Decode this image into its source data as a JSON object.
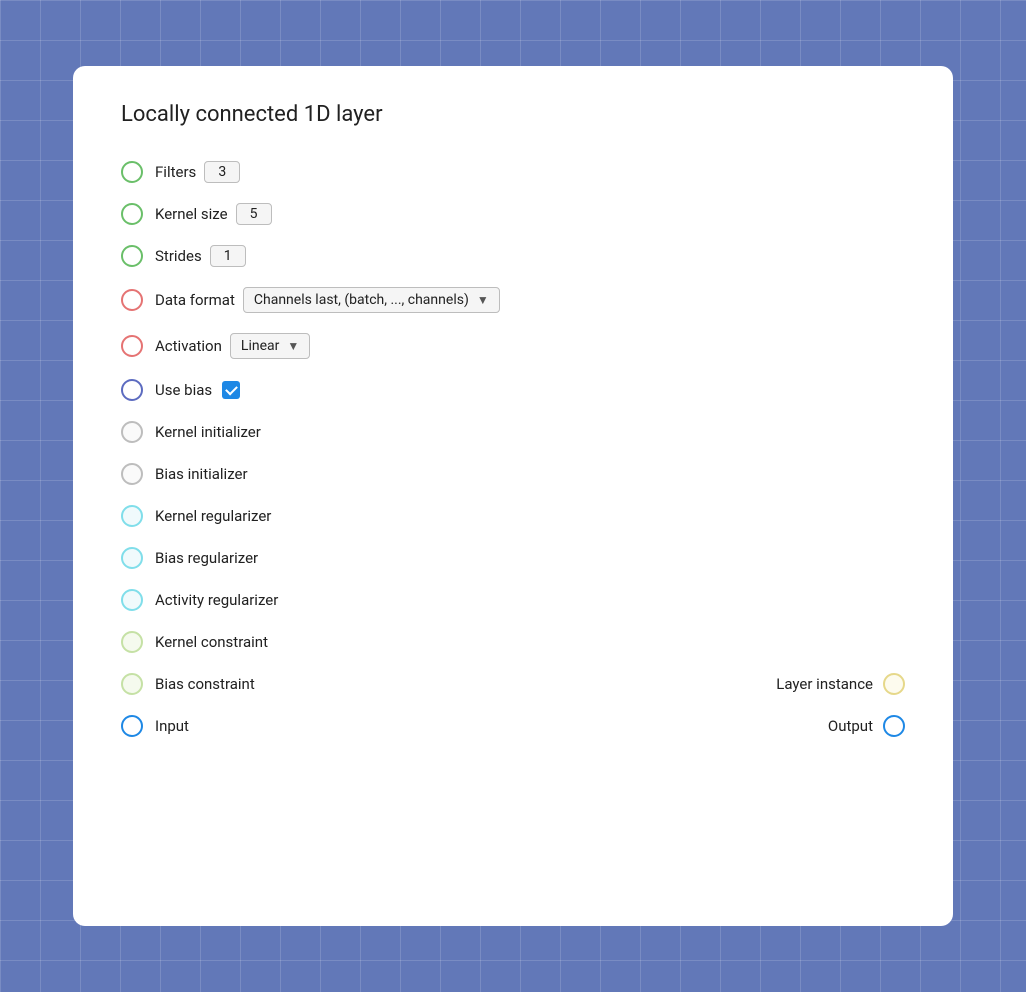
{
  "card": {
    "title": "Locally connected 1D layer",
    "rows": [
      {
        "id": "filters",
        "label": "Filters",
        "circle_type": "circle-green",
        "control_type": "number",
        "value": "3"
      },
      {
        "id": "kernel-size",
        "label": "Kernel size",
        "circle_type": "circle-green",
        "control_type": "number",
        "value": "5"
      },
      {
        "id": "strides",
        "label": "Strides",
        "circle_type": "circle-green",
        "control_type": "number",
        "value": "1"
      },
      {
        "id": "data-format",
        "label": "Data format",
        "circle_type": "circle-red",
        "control_type": "dropdown",
        "value": "Channels last, (batch, ..., channels)"
      },
      {
        "id": "activation",
        "label": "Activation",
        "circle_type": "circle-red",
        "control_type": "dropdown-small",
        "value": "Linear"
      },
      {
        "id": "use-bias",
        "label": "Use bias",
        "circle_type": "circle-blue-outline",
        "control_type": "checkbox",
        "checked": true
      },
      {
        "id": "kernel-initializer",
        "label": "Kernel initializer",
        "circle_type": "circle-gray-light",
        "control_type": "none"
      },
      {
        "id": "bias-initializer",
        "label": "Bias initializer",
        "circle_type": "circle-gray-light",
        "control_type": "none"
      },
      {
        "id": "kernel-regularizer",
        "label": "Kernel regularizer",
        "circle_type": "circle-cyan-light",
        "control_type": "none"
      },
      {
        "id": "bias-regularizer",
        "label": "Bias regularizer",
        "circle_type": "circle-cyan-light",
        "control_type": "none"
      },
      {
        "id": "activity-regularizer",
        "label": "Activity regularizer",
        "circle_type": "circle-cyan-light",
        "control_type": "none"
      },
      {
        "id": "kernel-constraint",
        "label": "Kernel constraint",
        "circle_type": "circle-lime-light",
        "control_type": "none"
      },
      {
        "id": "bias-constraint",
        "label": "Bias constraint",
        "circle_type": "circle-lime-light",
        "control_type": "none",
        "right_label": "Layer instance",
        "right_circle": "circle-yellow-light"
      },
      {
        "id": "input",
        "label": "Input",
        "circle_type": "circle-blue-solid",
        "control_type": "none",
        "right_label": "Output",
        "right_circle": "circle-blue-output"
      }
    ]
  }
}
